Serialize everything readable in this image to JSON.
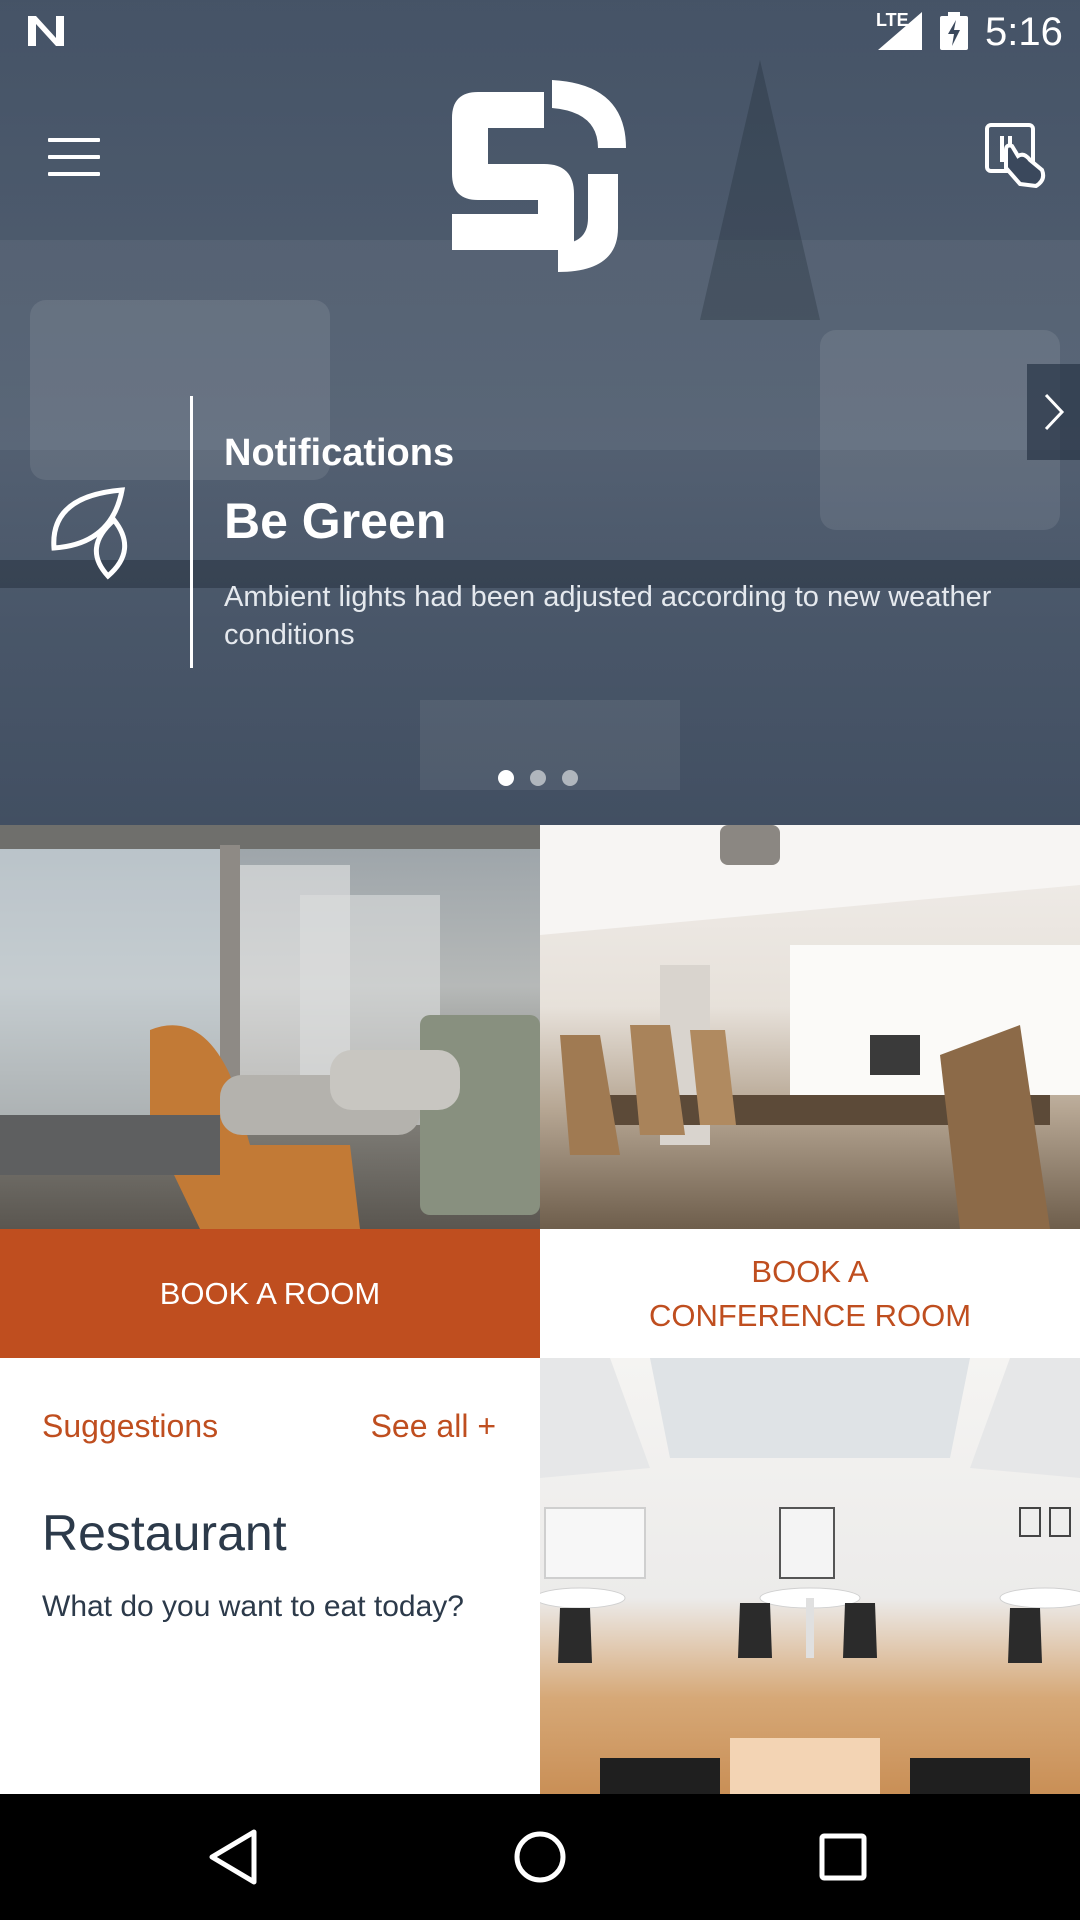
{
  "status_bar": {
    "network": "LTE",
    "time": "5:16",
    "icons": [
      "n-logo-icon",
      "signal-icon",
      "battery-charging-icon"
    ]
  },
  "header": {
    "menu_icon": "hamburger-menu-icon",
    "logo": "sh-logo",
    "action_icon": "touch-tap-icon"
  },
  "notification": {
    "heading": "Notifications",
    "title": "Be Green",
    "body": "Ambient lights had been adjusted according to new weather conditions",
    "icon": "leaf-icon",
    "carousel": {
      "pages": 3,
      "active": 1
    }
  },
  "tiles": {
    "book_room": {
      "label": "BOOK A ROOM"
    },
    "book_conference": {
      "label_line1": "BOOK A",
      "label_line2": "CONFERENCE ROOM"
    }
  },
  "suggestions": {
    "label": "Suggestions",
    "see_all": "See all +",
    "title": "Restaurant",
    "description": "What do you want to eat today?"
  },
  "colors": {
    "accent": "#bf4e1f",
    "hero_overlay": "#3a485c",
    "text_dark": "#2c3a4a"
  }
}
